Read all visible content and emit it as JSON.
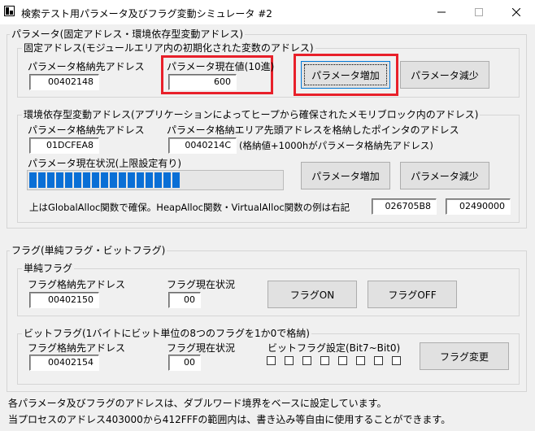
{
  "window": {
    "title": "検索テスト用パラメータ及びフラグ変動シミュレータ #2"
  },
  "parameter_group": {
    "legend": "パラメータ(固定アドレス・環境依存型変動アドレス)",
    "fixed": {
      "legend": "固定アドレス(モジュールエリア内の初期化された変数のアドレス)",
      "address_label": "パラメータ格納先アドレス",
      "address_value": "00402148",
      "current_label": "パラメータ現在値(10進)",
      "current_value": "600",
      "increase_button": "パラメータ増加",
      "decrease_button": "パラメータ減少"
    },
    "dynamic": {
      "legend": "環境依存型変動アドレス(アプリケーションによってヒープから確保されたメモリブロック内のアドレス)",
      "address_label": "パラメータ格納先アドレス",
      "address_value": "01DCFEA8",
      "pointer_label": "パラメータ格納エリア先頭アドレスを格納したポインタのアドレス",
      "pointer_value": "0040214C",
      "pointer_note": "(格納値+1000hがパラメータ格納先アドレス)",
      "status_label": "パラメータ現在状況(上限設定有り)",
      "progress_segments": 17,
      "increase_button": "パラメータ増加",
      "decrease_button": "パラメータ減少",
      "alloc_note": "上はGlobalAlloc関数で確保。HeapAlloc関数・VirtualAlloc関数の例は右記",
      "heap_value": "026705B8",
      "virtual_value": "02490000"
    }
  },
  "flag_group": {
    "legend": "フラグ(単純フラグ・ビットフラグ)",
    "simple": {
      "legend": "単純フラグ",
      "address_label": "フラグ格納先アドレス",
      "address_value": "00402150",
      "status_label": "フラグ現在状況",
      "status_value": "00",
      "on_button": "フラグON",
      "off_button": "フラグOFF"
    },
    "bit": {
      "legend": "ビットフラグ(1バイトにビット単位の8つのフラグを1か0で格納)",
      "address_label": "フラグ格納先アドレス",
      "address_value": "00402154",
      "status_label": "フラグ現在状況",
      "status_value": "00",
      "bits_label": "ビットフラグ設定(Bit7~Bit0)",
      "change_button": "フラグ変更"
    }
  },
  "footer": {
    "line1": "各パラメータ及びフラグのアドレスは、ダブルワード境界をベースに設定しています。",
    "line2": "当プロセスのアドレス403000から412FFFの範囲内は、書き込み等自由に使用することができます。"
  },
  "colors": {
    "highlight": "#e8202a",
    "progress": "#0a6fd6"
  }
}
